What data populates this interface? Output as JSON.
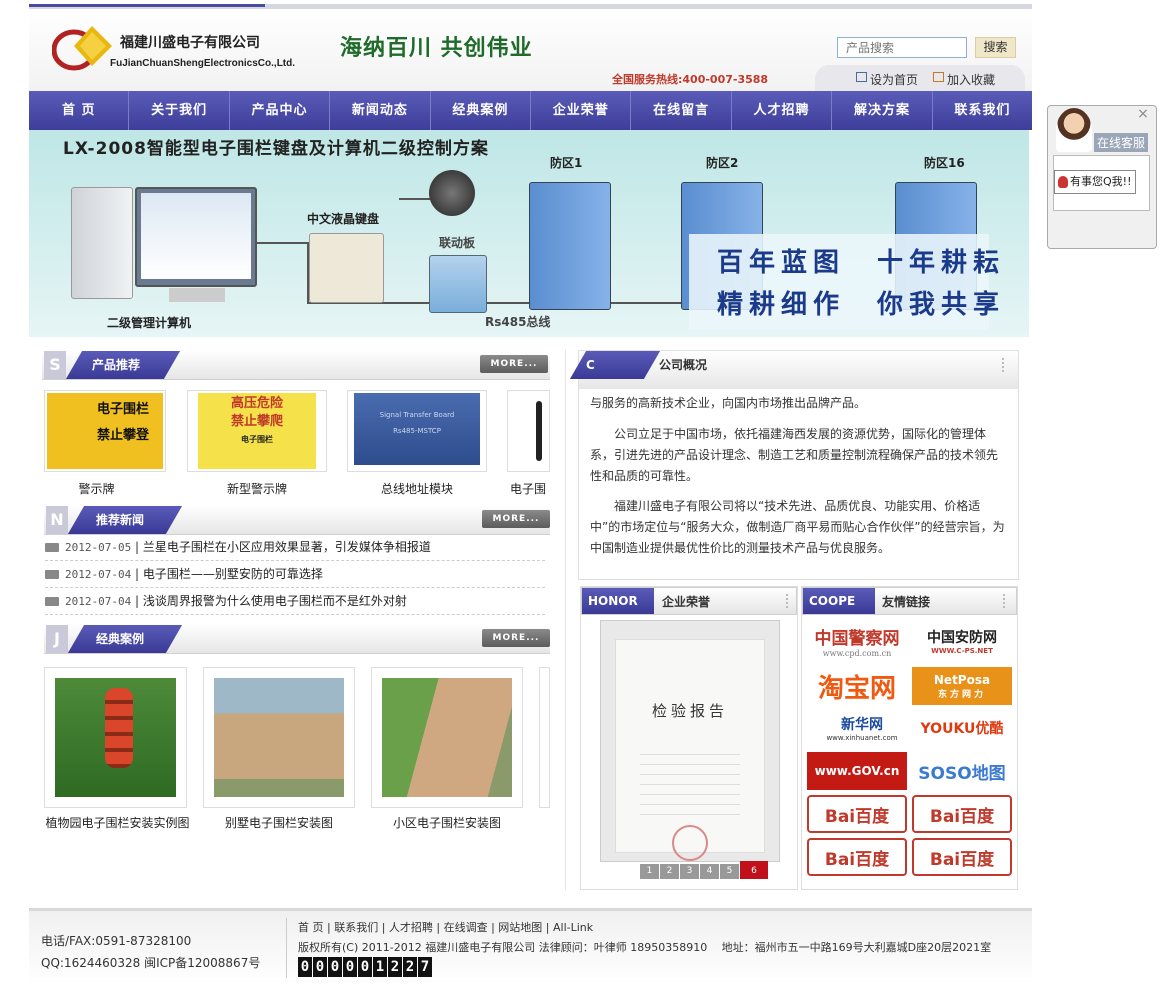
{
  "header": {
    "company_cn": "福建川盛电子有限公司",
    "company_en": "FuJianChuanShengElectronicsCo.,Ltd.",
    "slogan": "海纳百川 共创伟业",
    "hotline": "全国服务热线:400-007-3588",
    "search_placeholder": "产品搜索",
    "search_button": "搜索",
    "set_home": "设为首页",
    "add_favorite": "加入收藏"
  },
  "nav": [
    "首 页",
    "关于我们",
    "产品中心",
    "新闻动态",
    "经典案例",
    "企业荣誉",
    "在线留言",
    "人才招聘",
    "解决方案",
    "联系我们"
  ],
  "banner": {
    "title": "LX-2008智能型电子围栏键盘及计算机二级控制方案",
    "zone1": "防区1",
    "zone2": "防区2",
    "zone16": "防区16",
    "keyboard_label": "中文液晶键盘",
    "linkage_label": "联动板",
    "computer_label": "二级管理计算机",
    "bus_label": "Rs485总线",
    "slogan_line1": "百年蓝图　十年耕耘",
    "slogan_line2": "精耕细作　你我共享"
  },
  "service": {
    "label": "在线客服",
    "qq_button": "有事您Q我!!",
    "close": "×"
  },
  "products": {
    "letter": "S",
    "title": "产品推荐",
    "more": "MORE...",
    "items": [
      {
        "name": "警示牌",
        "img_text1": "电子围栏",
        "img_text2": "禁止攀登"
      },
      {
        "name": "新型警示牌",
        "img_text1": "高压危险",
        "img_text2": "禁止攀爬",
        "img_small": "电子围栏"
      },
      {
        "name": "总线地址模块",
        "img_text1": "Signal Transfer Board",
        "img_text2": "Rs485-MSTCP"
      },
      {
        "name": "电子围"
      }
    ]
  },
  "news": {
    "letter": "N",
    "title": "推荐新闻",
    "more": "MORE...",
    "items": [
      {
        "date": "2012-07-05",
        "title": "兰星电子围栏在小区应用效果显著，引发媒体争相报道"
      },
      {
        "date": "2012-07-04",
        "title": "电子围栏——别墅安防的可靠选择"
      },
      {
        "date": "2012-07-04",
        "title": "浅谈周界报警为什么使用电子围栏而不是红外对射"
      }
    ]
  },
  "cases": {
    "letter": "J",
    "title": "经典案例",
    "more": "MORE...",
    "items": [
      {
        "name": "植物园电子围栏安装实例图"
      },
      {
        "name": "别墅电子围栏安装图"
      },
      {
        "name": "小区电子围栏安装图"
      }
    ]
  },
  "about": {
    "letter": "C",
    "title": "公司概况",
    "paragraphs": [
      "与服务的高新技术企业，向国内市场推出品牌产品。",
      "　　公司立足于中国市场，依托福建海西发展的资源优势，国际化的管理体系，引进先进的产品设计理念、制造工艺和质量控制流程确保产品的技术领先性和品质的可靠性。",
      "　　福建川盛电子有限公司将以“技术先进、品质优良、功能实用、价格适中”的市场定位与“服务大众，做制造厂商平易而贴心合作伙伴”的经营宗旨，为中国制造业提供最优性价比的测量技术产品与优良服务。"
    ]
  },
  "honor": {
    "badge": "HONOR",
    "title": "企业荣誉",
    "cert_title": "检验报告",
    "pages": [
      "1",
      "2",
      "3",
      "4",
      "5",
      "6"
    ],
    "active_page": "6"
  },
  "links": {
    "badge": "COOPE",
    "title": "友情链接",
    "items": [
      {
        "name": "中国警察网",
        "sub": "www.cpd.com.cn"
      },
      {
        "name": "中国安防网",
        "sub": "WWW.C-PS.NET"
      },
      {
        "name": "淘宝网"
      },
      {
        "name": "NetPosa",
        "sub": "东方网力"
      },
      {
        "name": "新华网",
        "sub": "www.xinhuanet.com"
      },
      {
        "name": "YOUKU优酷"
      },
      {
        "name": "www.GOV.cn"
      },
      {
        "name": "SOSO地图"
      },
      {
        "name": "Bai百度"
      },
      {
        "name": "Bai百度"
      },
      {
        "name": "Bai百度"
      },
      {
        "name": "Bai百度"
      }
    ]
  },
  "footer": {
    "phone": "电话/FAX:0591-87328100",
    "qq": "QQ:1624460328 闽ICP备12008867号",
    "links": "首 页 | 联系我们 | 人才招聘 | 在线调查 | 网站地图 | All-Link",
    "copyright": "版权所有(C) 2011-2012 福建川盛电子有限公司 法律顾问：叶律师 18950358910　 地址：福州市五一中路169号大利嘉城D座20层2021室",
    "counter": [
      "0",
      "0",
      "0",
      "0",
      "0",
      "1",
      "2",
      "2",
      "7"
    ]
  },
  "colors": {
    "nav": "#4a4aa8",
    "hotline": "#c0392b",
    "slogan": "#1f6b2a",
    "banner_bg": "#cdeaea"
  }
}
